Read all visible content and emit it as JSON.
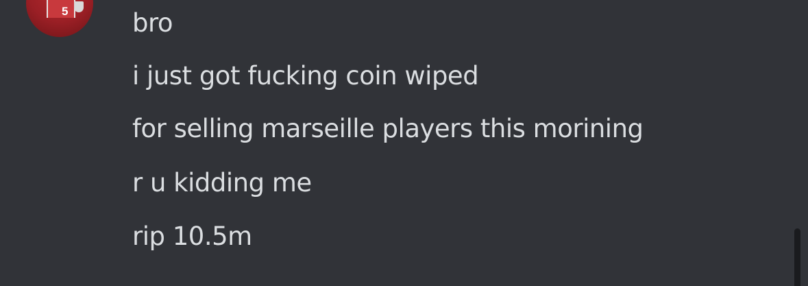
{
  "avatar": {
    "jersey_number": "5"
  },
  "messages": [
    {
      "text": "bro"
    },
    {
      "text": "i just got fucking coin wiped"
    },
    {
      "text": "for selling marseille players this morining"
    },
    {
      "text": "r u kidding me"
    },
    {
      "text": "rip 10.5m"
    }
  ],
  "colors": {
    "background": "#313338",
    "message_text": "#dbdee1",
    "scrollbar_thumb": "#1a1b1e"
  }
}
